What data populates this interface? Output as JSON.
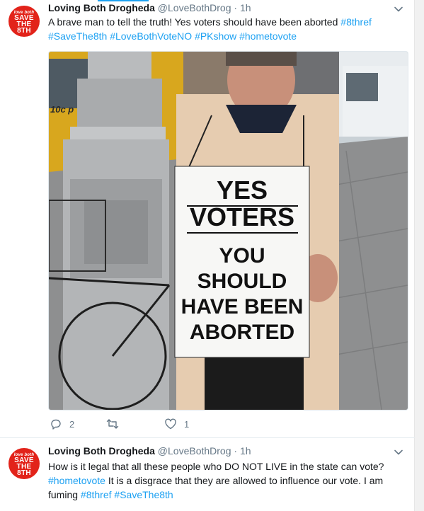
{
  "tweets": [
    {
      "author_name": "Loving Both Drogheda",
      "handle": "@LoveBothDrog",
      "separator": "·",
      "time": "1h",
      "text_plain": "A brave man to tell the truth! Yes voters should have been aborted",
      "hashtags": [
        "#8thref",
        "#SaveThe8th",
        "#LoveBothVoteNO",
        "#PKshow",
        "#hometovote"
      ],
      "sign_lines": [
        "YES",
        "VOTERS",
        "YOU",
        "SHOULD",
        "HAVE BEEN",
        "ABORTED"
      ],
      "reply_count": "2",
      "retweet_count": "",
      "like_count": "1"
    },
    {
      "author_name": "Loving Both Drogheda",
      "handle": "@LoveBothDrog",
      "separator": "·",
      "time": "1h",
      "text_part1": "How is it legal that all these people who DO NOT LIVE in the state can vote?",
      "hashtag1": "#hometovote",
      "text_part2": "  It is a disgrace that they are allowed to influence our vote. I am fuming",
      "hashtag2": "#8thref",
      "hashtag3": "#SaveThe8th"
    }
  ],
  "avatar": {
    "small_text": "love both",
    "line1": "SAVE",
    "line2": "THE",
    "line3": "8TH"
  },
  "icons": {
    "reply": "reply-icon",
    "retweet": "retweet-icon",
    "like": "heart-icon",
    "menu": "chevron-down-icon"
  },
  "colors": {
    "accent": "#1da1f2",
    "avatar_red": "#e2231a",
    "muted": "#657786"
  }
}
